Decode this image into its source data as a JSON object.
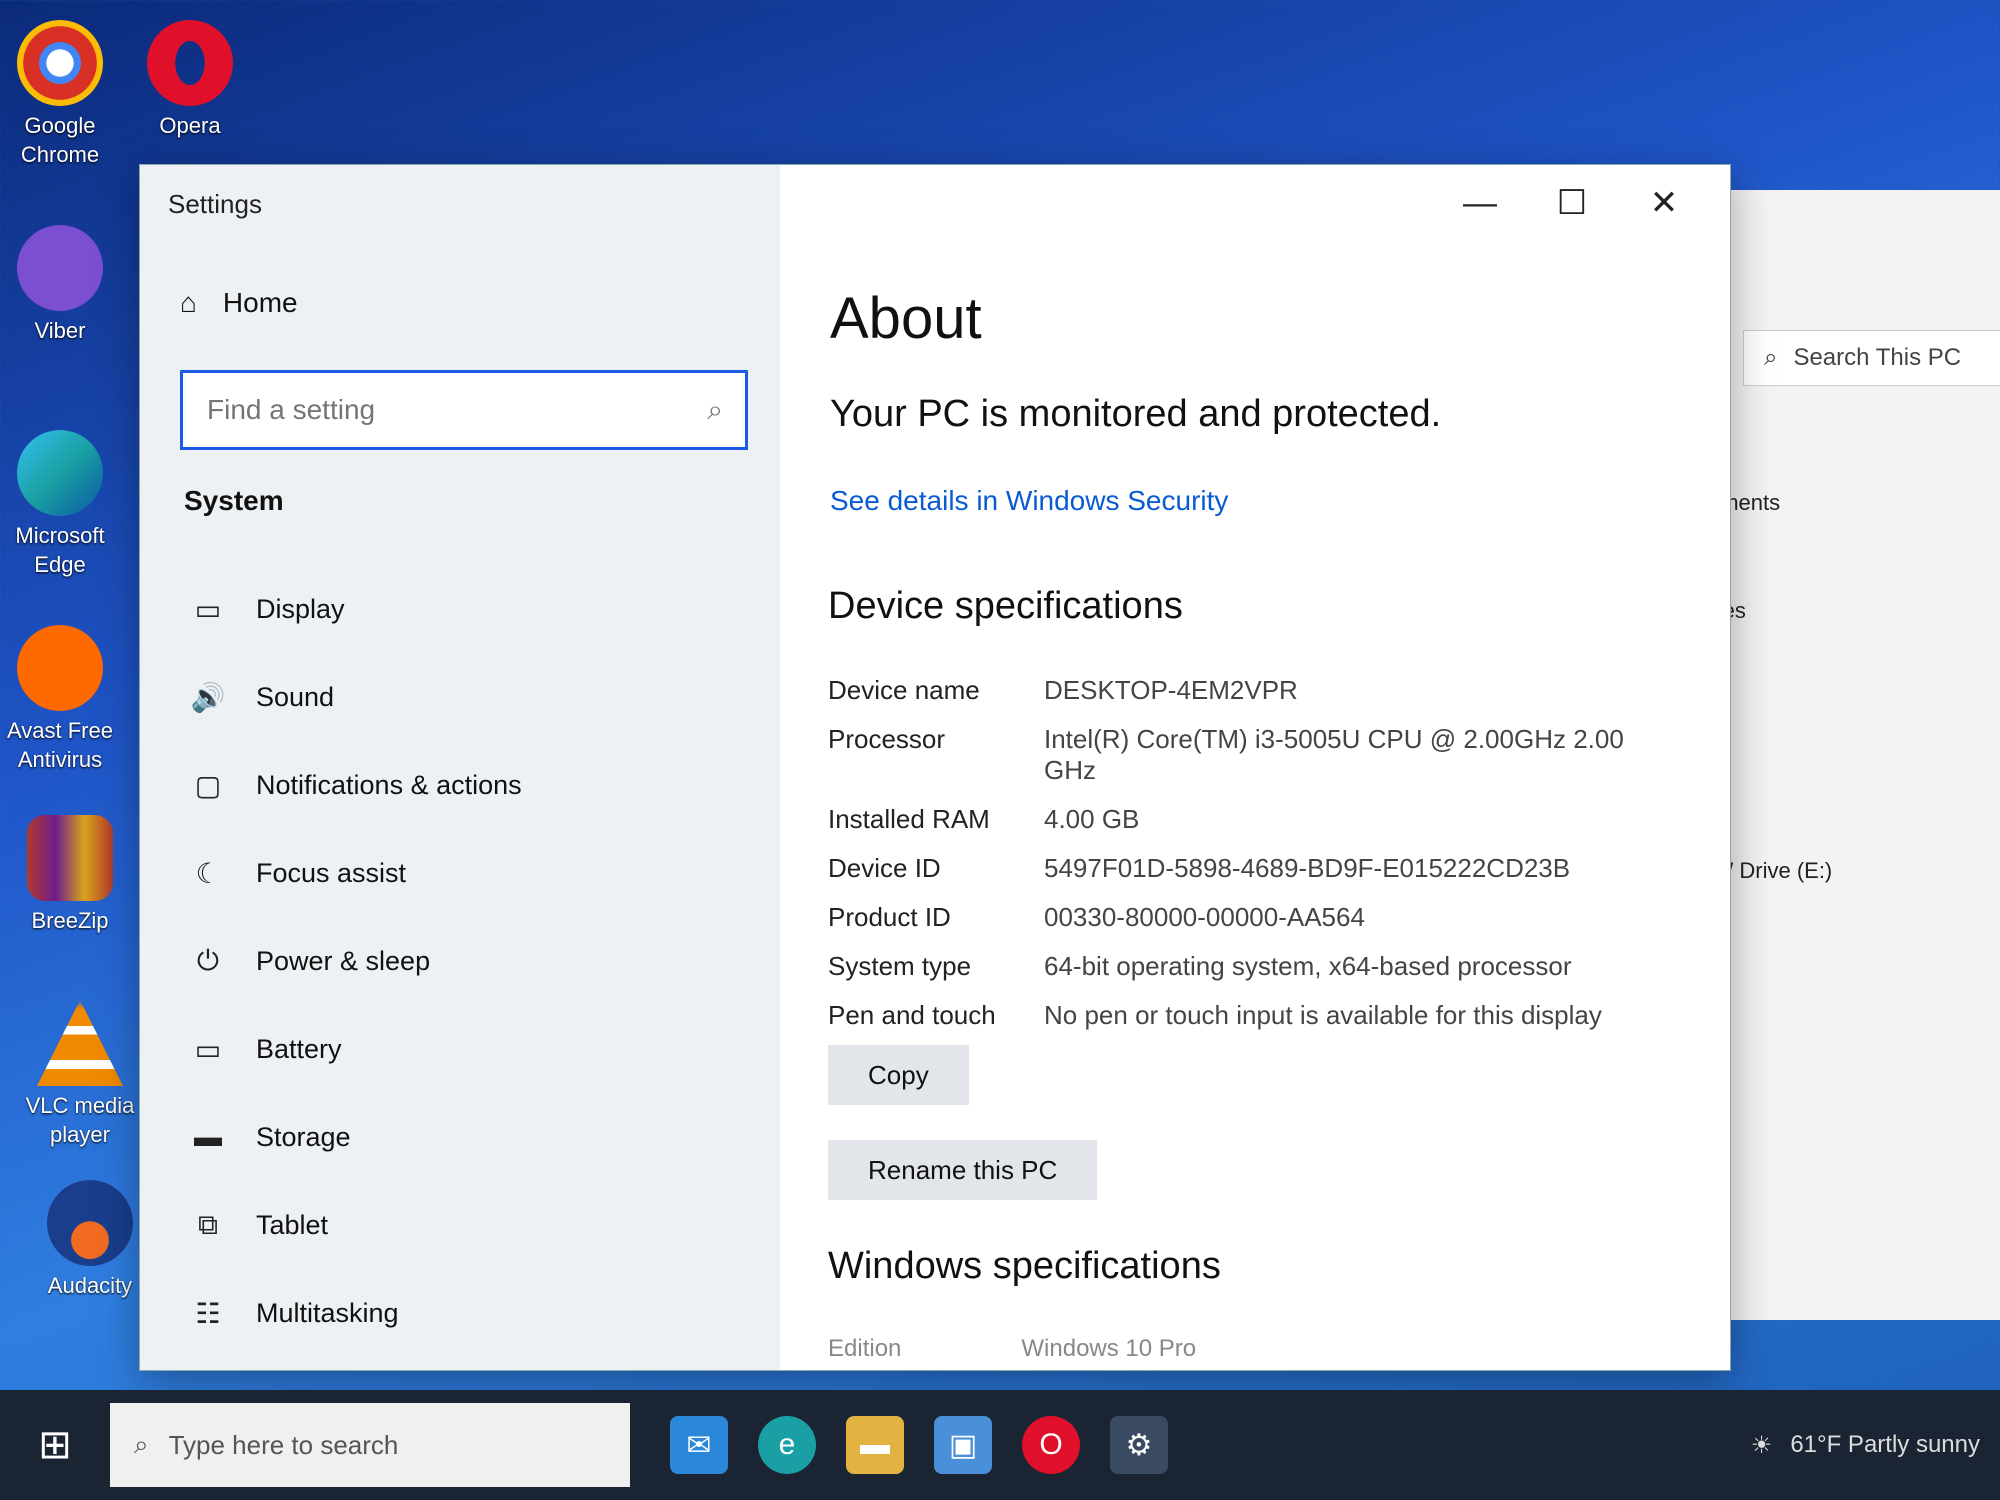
{
  "desktop": {
    "icons": [
      {
        "name": "Google Chrome",
        "color": "#d93025"
      },
      {
        "name": "Opera",
        "color": "#e0102a"
      },
      {
        "name": "Viber",
        "color": "#7b4fd1"
      },
      {
        "name": "Microsoft Edge",
        "color": "#1aa0a4"
      },
      {
        "name": "Avast Free Antivirus",
        "color": "#ff6a00"
      },
      {
        "name": "BreeZip",
        "color": "#b2392d"
      },
      {
        "name": "VLC media player",
        "color": "#f08a00"
      },
      {
        "name": "Audacity",
        "color": "#1a3e8c"
      }
    ]
  },
  "explorer": {
    "search_placeholder": "Search This PC",
    "items": [
      "cuments",
      "tures",
      "RW Drive (E:)"
    ]
  },
  "settings": {
    "window_title": "Settings",
    "home_label": "Home",
    "search_placeholder": "Find a setting",
    "section_label": "System",
    "nav": [
      {
        "label": "Display",
        "icon": "monitor-icon"
      },
      {
        "label": "Sound",
        "icon": "speaker-icon"
      },
      {
        "label": "Notifications & actions",
        "icon": "notification-icon"
      },
      {
        "label": "Focus assist",
        "icon": "moon-icon"
      },
      {
        "label": "Power & sleep",
        "icon": "power-icon"
      },
      {
        "label": "Battery",
        "icon": "battery-icon"
      },
      {
        "label": "Storage",
        "icon": "storage-icon"
      },
      {
        "label": "Tablet",
        "icon": "tablet-icon"
      },
      {
        "label": "Multitasking",
        "icon": "multitasking-icon"
      }
    ],
    "controls": {
      "minimize": "—",
      "maximize": "☐",
      "close": "✕"
    }
  },
  "about": {
    "title": "About",
    "protection": "Your PC is monitored and protected.",
    "security_link": "See details in Windows Security",
    "device_heading": "Device specifications",
    "specs": [
      {
        "key": "Device name",
        "value": "DESKTOP-4EM2VPR"
      },
      {
        "key": "Processor",
        "value": "Intel(R) Core(TM) i3-5005U CPU @ 2.00GHz   2.00 GHz"
      },
      {
        "key": "Installed RAM",
        "value": "4.00 GB"
      },
      {
        "key": "Device ID",
        "value": "5497F01D-5898-4689-BD9F-E015222CD23B"
      },
      {
        "key": "Product ID",
        "value": "00330-80000-00000-AA564"
      },
      {
        "key": "System type",
        "value": "64-bit operating system, x64-based processor"
      },
      {
        "key": "Pen and touch",
        "value": "No pen or touch input is available for this display"
      }
    ],
    "copy_label": "Copy",
    "rename_label": "Rename this PC",
    "windows_heading": "Windows specifications",
    "edition_key": "Edition",
    "edition_value": "Windows 10 Pro"
  },
  "taskbar": {
    "search_placeholder": "Type here to search",
    "weather": "61°F  Partly sunny"
  }
}
